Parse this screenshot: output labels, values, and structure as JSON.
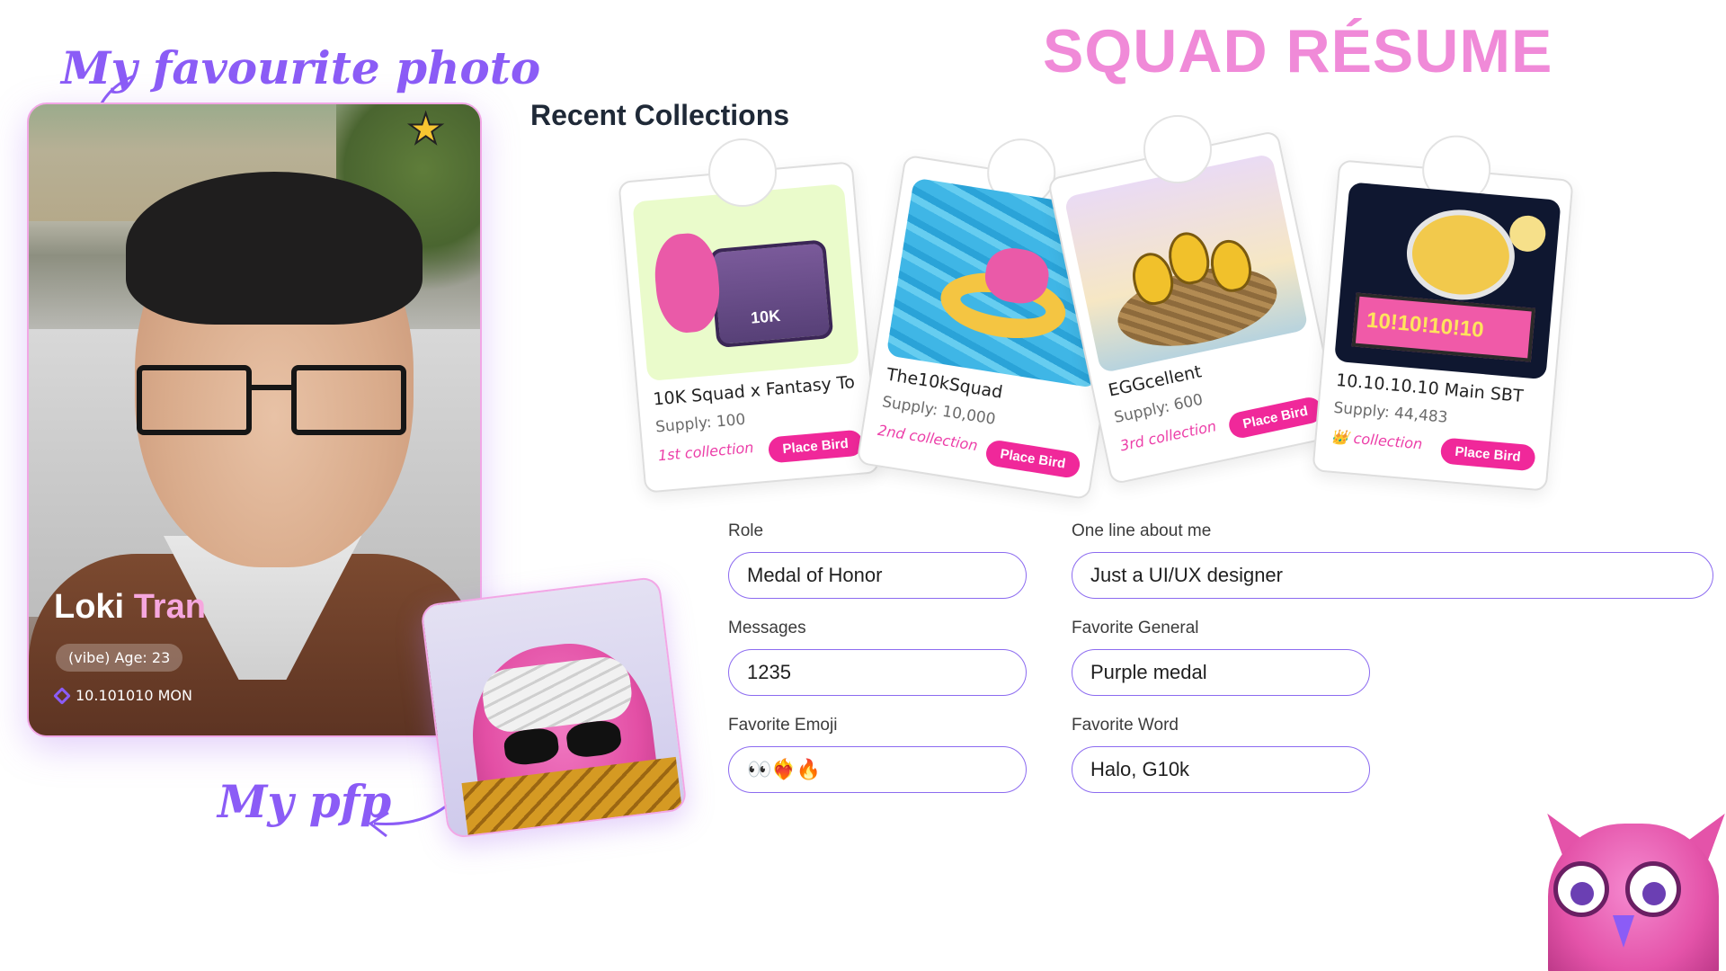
{
  "header": {
    "title": "SQUAD RÉSUME"
  },
  "annotations": {
    "photo": "My favourite photo",
    "pfp": "My pfp"
  },
  "profile": {
    "first_name": "Loki",
    "last_name": "Tran",
    "vibe": "(vibe) Age: 23",
    "balance": "10.101010 MON",
    "star_icon": "star-icon",
    "token_icon": "diamond-icon"
  },
  "collections": {
    "heading": "Recent Collections",
    "items": [
      {
        "name": "10K Squad x Fantasy To",
        "supply": "Supply: 100",
        "tag": "1st collection",
        "button": "Place Bird"
      },
      {
        "name": "The10kSquad",
        "supply": "Supply: 10,000",
        "tag": "2nd collection",
        "button": "Place Bird"
      },
      {
        "name": "EGGcellent",
        "supply": "Supply: 600",
        "tag": "3rd collection",
        "button": "Place Bird"
      },
      {
        "name": "10.10.10.10 Main SBT",
        "supply": "Supply: 44,483",
        "tag": "👑 collection",
        "button": "Place Bird"
      }
    ],
    "art_text": {
      "chest": "10K",
      "sbt": "10!10!10!10"
    }
  },
  "form": {
    "role": {
      "label": "Role",
      "value": "Medal of Honor"
    },
    "about": {
      "label": "One line about me",
      "value": "Just a UI/UX designer"
    },
    "messages": {
      "label": "Messages",
      "value": "1235"
    },
    "general": {
      "label": "Favorite General",
      "value": "Purple medal"
    },
    "emoji": {
      "label": "Favorite Emoji",
      "value": "👀❤️‍🔥🔥"
    },
    "word": {
      "label": "Favorite Word",
      "value": "Halo, G10k"
    }
  },
  "colors": {
    "accent": "#8b5cf6",
    "brand_pink": "#f08ad8",
    "button_pink": "#f0289a"
  }
}
